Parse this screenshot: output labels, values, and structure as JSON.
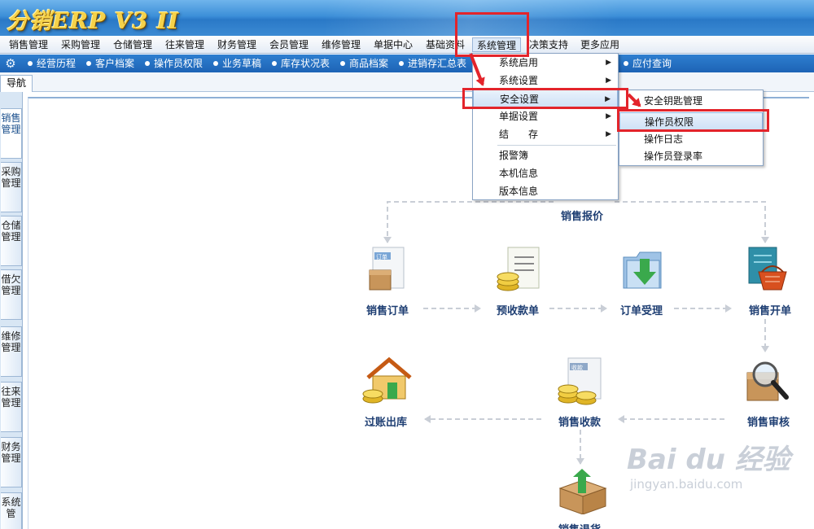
{
  "app": {
    "logo": "分销ERP V3 II"
  },
  "menubar": {
    "items": [
      "销售管理",
      "采购管理",
      "仓储管理",
      "往来管理",
      "财务管理",
      "会员管理",
      "维修管理",
      "单据中心",
      "基础资料",
      "系统管理",
      "决策支持",
      "更多应用"
    ],
    "active": "系统管理"
  },
  "quickbar": {
    "items": [
      "经营历程",
      "客户档案",
      "操作员权限",
      "业务草稿",
      "库存状况表",
      "商品档案",
      "进销存汇总表",
      "应付查询"
    ]
  },
  "tabs": {
    "nav": "导航"
  },
  "leftnav": {
    "items": [
      "销售管理",
      "采购管理",
      "仓储管理",
      "借欠管理",
      "维修管理",
      "往来管理",
      "财务管理",
      "系统管"
    ]
  },
  "system_menu": {
    "items": [
      {
        "label": "系统启用",
        "submenu": true
      },
      {
        "label": "系统设置",
        "submenu": true
      },
      {
        "label": "安全设置",
        "submenu": true
      },
      {
        "label": "单据设置",
        "submenu": true
      },
      {
        "label": "结　　存",
        "submenu": true
      },
      {
        "label": "报警簿",
        "submenu": false
      },
      {
        "label": "本机信息",
        "submenu": false
      },
      {
        "label": "版本信息",
        "submenu": false
      }
    ],
    "highlighted": "安全设置"
  },
  "security_submenu": {
    "items": [
      "安全钥匙管理",
      "操作员权限",
      "操作日志",
      "操作员登录率"
    ],
    "highlighted": "操作员权限"
  },
  "flow": {
    "title": "销售报价",
    "nodes": {
      "order": "销售订单",
      "prepay": "预收款单",
      "accept": "订单受理",
      "invoice": "销售开单",
      "audit": "销售审核",
      "receipt": "销售收款",
      "posting": "过账出库",
      "return": "销售退货"
    },
    "icon_tags": {
      "order": "订单",
      "receipt": "收款"
    }
  },
  "watermark": {
    "brand": "Bai du 经验",
    "url": "jingyan.baidu.com"
  },
  "colors": {
    "accent": "#2a79c7",
    "annotation": "#e3242b",
    "flow_text": "#1f3f73"
  }
}
